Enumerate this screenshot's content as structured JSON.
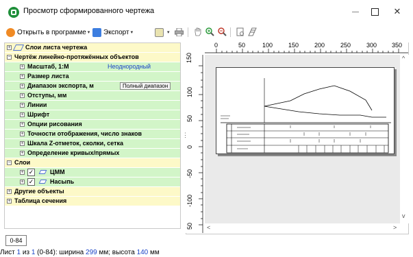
{
  "window": {
    "title": "Просмотр сформированного чертежа",
    "minimize_label": "—",
    "close_label": "✕"
  },
  "toolbar": {
    "open_in_program": "Открыть в программе",
    "export": "Экспорт",
    "caret": "▾",
    "icons": [
      "open-icon",
      "export-icon",
      "brush-icon",
      "print-icon",
      "hand-icon",
      "zoom-in-icon",
      "zoom-out-icon",
      "page-icon",
      "grid-icon"
    ]
  },
  "tree": {
    "items": [
      {
        "expander": "+",
        "label": "Слои листа чертежа",
        "color": "yellow"
      },
      {
        "expander": "−",
        "label": "Чертёж линейно-протяжённых объектов",
        "color": "yellow"
      },
      {
        "expander": "+",
        "label": "Масштаб, 1:М",
        "color": "green",
        "value": "Неоднородный"
      },
      {
        "expander": "+",
        "label": "Размер листа",
        "color": "green"
      },
      {
        "expander": "+",
        "label": "Диапазон экспорта, м",
        "color": "green",
        "value": "Полный диапазон"
      },
      {
        "expander": "+",
        "label": "Отступы, мм",
        "color": "green"
      },
      {
        "expander": "+",
        "label": "Линии",
        "color": "green"
      },
      {
        "expander": "+",
        "label": "Шрифт",
        "color": "green"
      },
      {
        "expander": "+",
        "label": "Опции рисования",
        "color": "green"
      },
      {
        "expander": "+",
        "label": "Точности отображения, число знаков",
        "color": "green"
      },
      {
        "expander": "+",
        "label": "Шкала Z-отметок, сколки, сетка",
        "color": "green"
      },
      {
        "expander": "+",
        "label": "Определение кривых/прямых",
        "color": "green"
      },
      {
        "expander": "−",
        "label": "Слои",
        "color": "yellow"
      },
      {
        "expander": "+",
        "label": "ЦММ",
        "color": "green",
        "checked": "✓"
      },
      {
        "expander": "+",
        "label": "Насыпь",
        "color": "green",
        "checked": "✓"
      },
      {
        "expander": "+",
        "label": "Другие объекты",
        "color": "yellow"
      },
      {
        "expander": "+",
        "label": "Таблица сечения",
        "color": "yellow"
      }
    ]
  },
  "ruler": {
    "top": [
      "0",
      "50",
      "100",
      "150",
      "200",
      "250",
      "300",
      "350"
    ],
    "left": [
      "150",
      "100",
      "50",
      "0",
      "-50",
      "-100",
      "50"
    ]
  },
  "scroll": {
    "up": "^",
    "down": "v",
    "left": "<",
    "right": ">"
  },
  "splitter_dots": "⋮",
  "sheet_tab": "0-84",
  "status": {
    "prefix": "Лист ",
    "sheet_num": "1",
    "of_text": " из ",
    "total": "1",
    "range": " (0-84)",
    "width_text": ": ширина ",
    "width_val": "299",
    "height_text": " мм; высота ",
    "height_val": "140",
    "unit": " мм"
  }
}
